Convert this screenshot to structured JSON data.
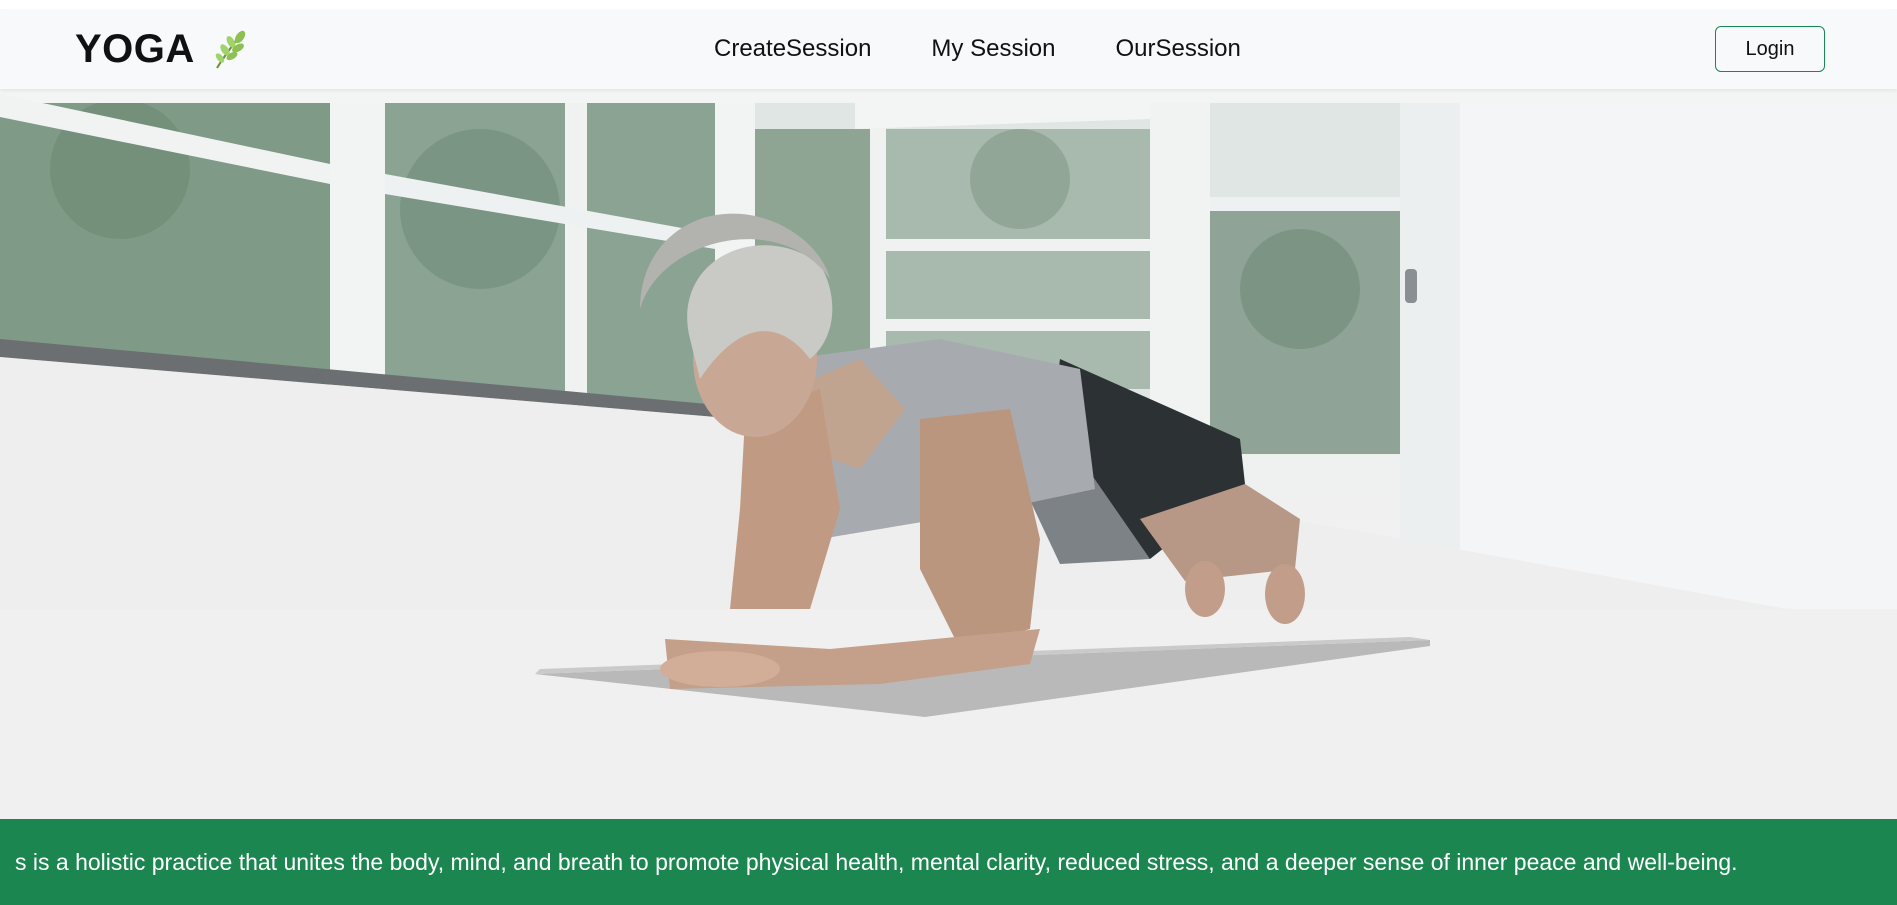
{
  "navbar": {
    "brand": "YOGA",
    "brand_icon": "leaf-icon",
    "links": [
      "CreateSession",
      "My Session",
      "OurSession"
    ],
    "login_label": "Login"
  },
  "hero": {
    "image": "woman-plank-pose-photo"
  },
  "marquee": {
    "text": "s is a holistic practice that unites the body, mind, and breath to promote physical health, mental clarity, reduced stress, and a deeper sense of inner peace and well-being."
  },
  "colors": {
    "accent": "#1b8650",
    "navbar_bg": "#f8f9fa",
    "login_border": "#198754"
  }
}
